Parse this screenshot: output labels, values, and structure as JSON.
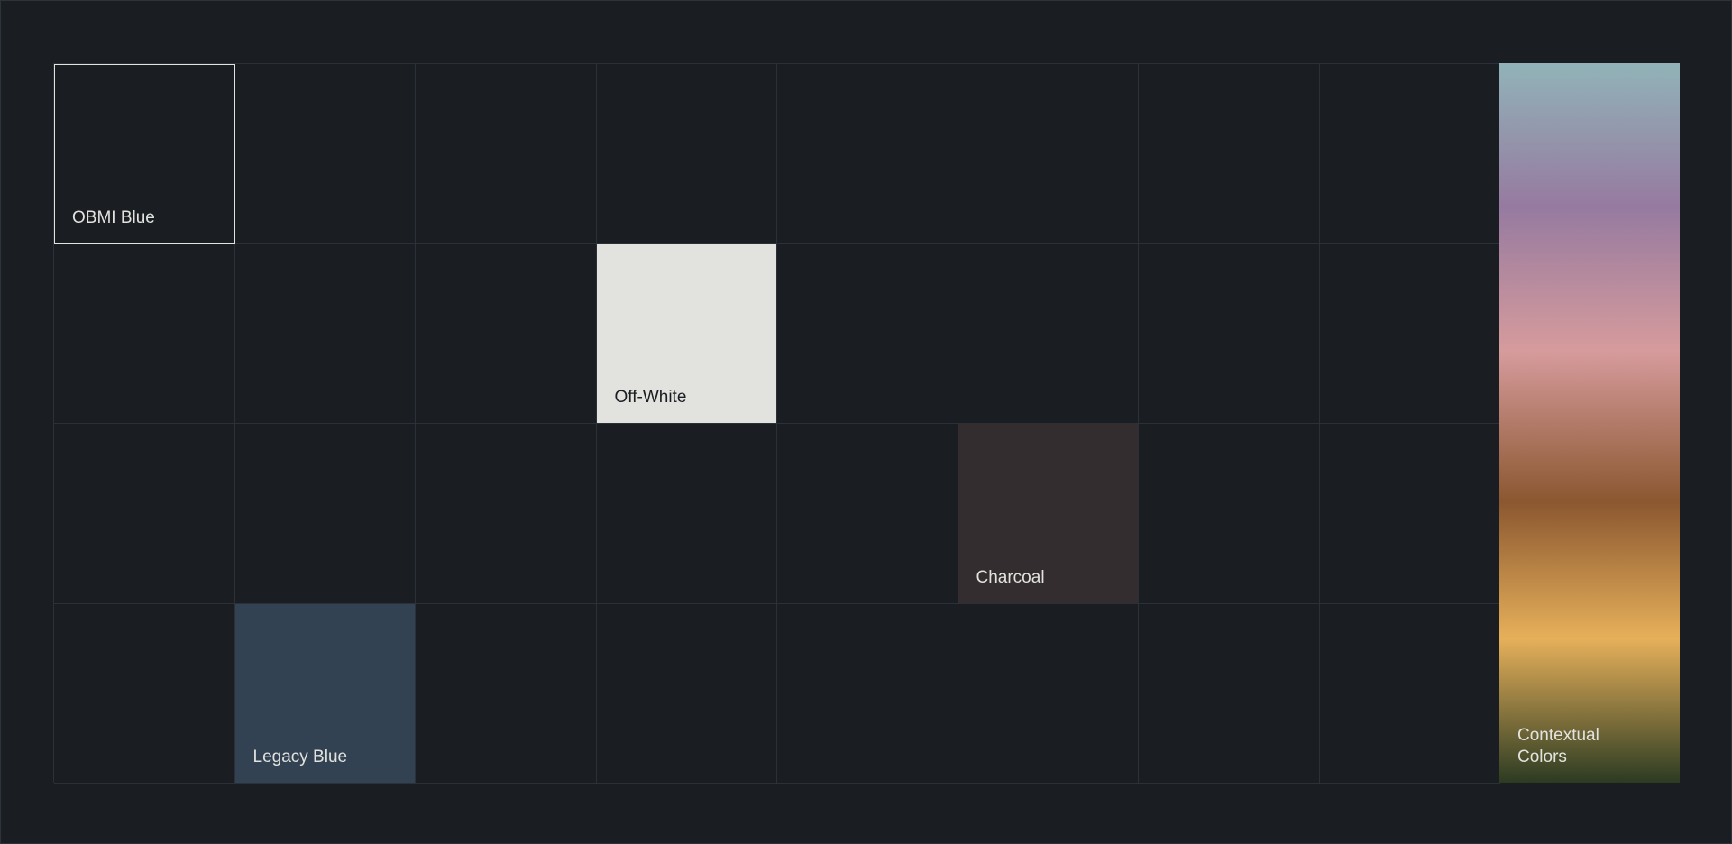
{
  "swatches": [
    {
      "id": "obmi",
      "label": "OBMI Blue",
      "row": 0,
      "col": 0,
      "fill": "#1a1d21",
      "text_color": "#e2e3df",
      "border": "#e2e3df"
    },
    {
      "id": "offwhite",
      "label": "Off-White",
      "row": 1,
      "col": 3,
      "fill": "#e2e3df",
      "text_color": "#1a1d21"
    },
    {
      "id": "charcoal",
      "label": "Charcoal",
      "row": 2,
      "col": 5,
      "fill": "#332d2f",
      "text_color": "#e2e3df"
    },
    {
      "id": "legacy",
      "label": "Legacy Blue",
      "row": 3,
      "col": 1,
      "fill": "#334252",
      "text_color": "#e2e3df"
    }
  ],
  "contextual": {
    "label": "Contextual Colors",
    "text_color": "#e2e3df",
    "gradient": [
      "#91b3b8",
      "#967aa0",
      "#d69b9c",
      "#8b5730",
      "#e6b05a",
      "#2c3b22"
    ]
  },
  "colors": {
    "background": "#1a1d21",
    "gridline": "#2a3139"
  }
}
